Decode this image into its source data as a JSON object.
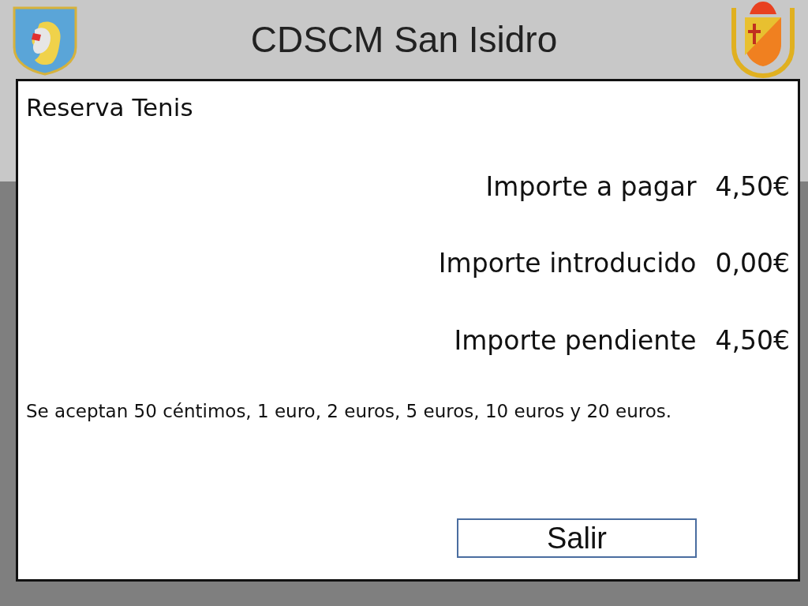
{
  "header": {
    "title": "CDSCM San Isidro"
  },
  "panel": {
    "title": "Reserva Tenis",
    "amounts": [
      {
        "label": "Importe a pagar",
        "value": "4,50€"
      },
      {
        "label": "Importe introducido",
        "value": "0,00€"
      },
      {
        "label": "Importe pendiente",
        "value": "4,50€"
      }
    ],
    "note": "Se aceptan 50 céntimos, 1 euro, 2 euros, 5 euros, 10 euros y 20 euros.",
    "buttons": [
      "Salir"
    ]
  }
}
